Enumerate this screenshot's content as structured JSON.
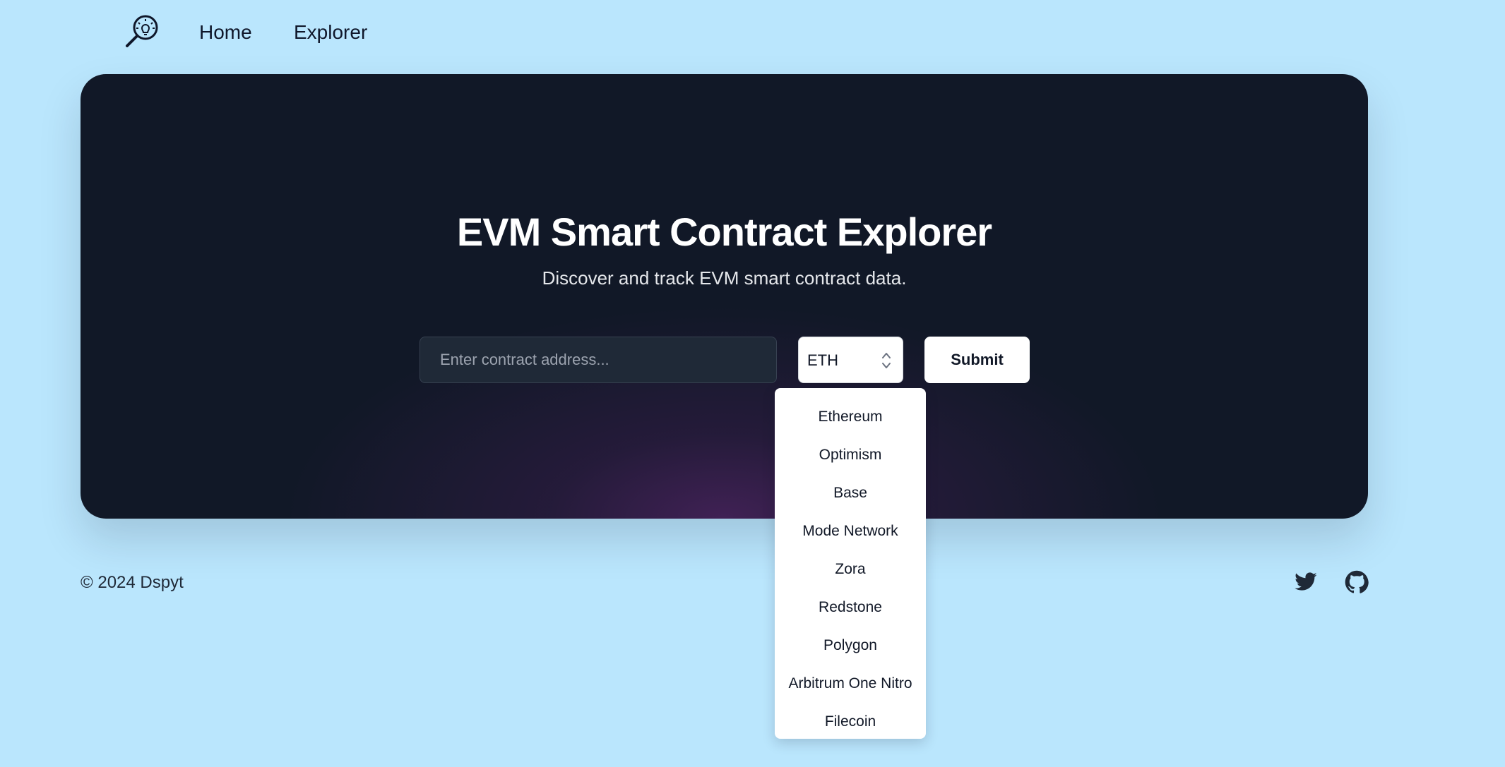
{
  "nav": {
    "logo_icon": "magnifier-lightbulb-icon",
    "links": [
      {
        "label": "Home"
      },
      {
        "label": "Explorer"
      }
    ]
  },
  "hero": {
    "title": "EVM Smart Contract Explorer",
    "subtitle": "Discover and track EVM smart contract data.",
    "address_input": {
      "value": "",
      "placeholder": "Enter contract address..."
    },
    "chain_select": {
      "selected": "ETH",
      "icon": "chevron-up-down-icon"
    },
    "submit_label": "Submit"
  },
  "dropdown": {
    "options": [
      "Ethereum",
      "Optimism",
      "Base",
      "Mode Network",
      "Zora",
      "Redstone",
      "Polygon",
      "Arbitrum One Nitro",
      "Filecoin"
    ]
  },
  "footer": {
    "copyright": "© 2024 Dspyt",
    "social_icons": [
      "twitter-icon",
      "github-icon"
    ]
  },
  "colors": {
    "page_bg": "#bae6fd",
    "hero_bg": "#111827",
    "hero_glow": "#502464",
    "text_dark": "#0f172a"
  }
}
